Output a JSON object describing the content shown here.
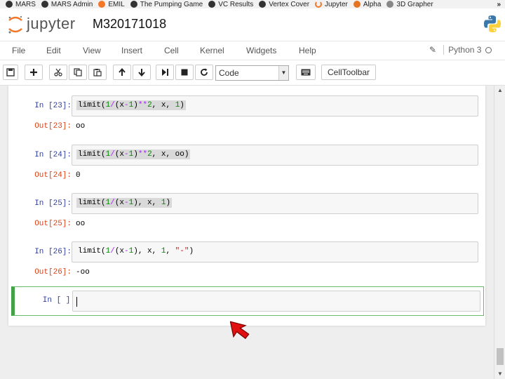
{
  "bookmarks": [
    {
      "label": "MARS",
      "icon": "mars-icon"
    },
    {
      "label": "MARS Admin",
      "icon": "mars-icon"
    },
    {
      "label": "EMIL",
      "icon": "emil-icon"
    },
    {
      "label": "The Pumping Game",
      "icon": "game-icon"
    },
    {
      "label": "VC Results",
      "icon": "vc-icon"
    },
    {
      "label": "Vertex Cover",
      "icon": "vc-icon"
    },
    {
      "label": "Jupyter",
      "icon": "jupyter-icon"
    },
    {
      "label": "Alpha",
      "icon": "alpha-icon"
    },
    {
      "label": "3D Grapher",
      "icon": "globe-icon"
    }
  ],
  "bookmarks_more": "»",
  "header": {
    "logo_text": "jupyter",
    "notebook_title": "M320171018"
  },
  "menu": {
    "items": [
      "File",
      "Edit",
      "View",
      "Insert",
      "Cell",
      "Kernel",
      "Widgets",
      "Help"
    ],
    "kernel_name": "Python 3"
  },
  "toolbar": {
    "buttons": [
      "save-icon",
      "plus-icon",
      "cut-icon",
      "copy-icon",
      "paste-icon",
      "arrow-up-icon",
      "arrow-down-icon",
      "step-forward-icon",
      "stop-icon",
      "restart-icon"
    ],
    "cell_type": "Code",
    "celltoolbar_label": "CellToolbar"
  },
  "cells": [
    {
      "prompt_in": "In [23]:",
      "code": "limit(1/(x-1)**2, x, 1)",
      "prompt_out": "Out[23]:",
      "output": "oo",
      "highlighted": true
    },
    {
      "prompt_in": "In [24]:",
      "code": "limit(1/(x-1)**2, x, oo)",
      "prompt_out": "Out[24]:",
      "output": "0",
      "highlighted": true
    },
    {
      "prompt_in": "In [25]:",
      "code": "limit(1/(x-1), x, 1)",
      "prompt_out": "Out[25]:",
      "output": "oo",
      "highlighted": true
    },
    {
      "prompt_in": "In [26]:",
      "code": "limit(1/(x-1), x, 1, \"-\")",
      "prompt_out": "Out[26]:",
      "output": "-oo",
      "highlighted": false
    }
  ],
  "active_cell": {
    "prompt_in": "In [ ]:",
    "code": ""
  },
  "colors": {
    "prompt_in": "#303f9f",
    "prompt_out": "#d84315",
    "active_cell_border": "#42a047",
    "jupyter_orange": "#f37726"
  }
}
